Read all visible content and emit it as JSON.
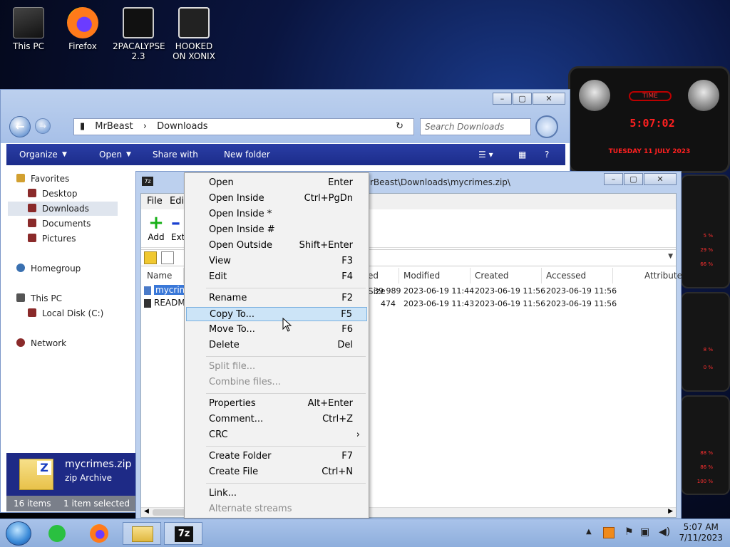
{
  "desktop": {
    "icons": [
      {
        "label": "This PC"
      },
      {
        "label": "Firefox"
      },
      {
        "label": "2PACALYPSE 2.3"
      },
      {
        "label": "HOOKED ON XONIX"
      }
    ]
  },
  "widget": {
    "time_label": "TIME",
    "time": "5:07:02",
    "date": "TUESDAY 11 JULY 2023",
    "readouts": [
      "5 %",
      "29 %",
      "66 %",
      "8 %",
      "0 %",
      "0 %",
      "88 %",
      "86 %",
      "100 %"
    ]
  },
  "explorer": {
    "breadcrumb": [
      "MrBeast",
      "Downloads"
    ],
    "search_placeholder": "Search Downloads",
    "toolbar": {
      "organize": "Organize",
      "open": "Open",
      "share_with": "Share with",
      "new_folder": "New folder"
    },
    "nav": {
      "favorites": "Favorites",
      "desktop": "Desktop",
      "downloads": "Downloads",
      "documents": "Documents",
      "pictures": "Pictures",
      "homegroup": "Homegroup",
      "this_pc": "This PC",
      "local_disk": "Local Disk (C:)",
      "network": "Network"
    },
    "details": {
      "name": "mycrimes.zip",
      "type": "zip Archive"
    },
    "status": {
      "items": "16 items",
      "selected": "1 item selected"
    }
  },
  "zip": {
    "title": "rBeast\\Downloads\\mycrimes.zip\\",
    "menu": {
      "file": "File",
      "edit": "Edi"
    },
    "tools": {
      "add": "Add",
      "extract": "Ext"
    },
    "columns": {
      "name": "Name",
      "size": "ed Size",
      "modified": "Modified",
      "created": "Created",
      "accessed": "Accessed",
      "attributes": "Attribute"
    },
    "rows": [
      {
        "name": "mycrim",
        "size": "39 989",
        "modified": "2023-06-19 11:44",
        "created": "2023-06-19 11:56",
        "accessed": "2023-06-19 11:56"
      },
      {
        "name": "READM",
        "size": "474",
        "modified": "2023-06-19 11:43",
        "created": "2023-06-19 11:56",
        "accessed": "2023-06-19 11:56"
      }
    ]
  },
  "context_menu": {
    "items": [
      {
        "label": "Open",
        "shortcut": "Enter"
      },
      {
        "label": "Open Inside",
        "shortcut": "Ctrl+PgDn"
      },
      {
        "label": "Open Inside *",
        "shortcut": ""
      },
      {
        "label": "Open Inside #",
        "shortcut": ""
      },
      {
        "label": "Open Outside",
        "shortcut": "Shift+Enter"
      },
      {
        "label": "View",
        "shortcut": "F3"
      },
      {
        "label": "Edit",
        "shortcut": "F4"
      },
      {
        "label": "Rename",
        "shortcut": "F2"
      },
      {
        "label": "Copy To...",
        "shortcut": "F5"
      },
      {
        "label": "Move To...",
        "shortcut": "F6"
      },
      {
        "label": "Delete",
        "shortcut": "Del"
      },
      {
        "label": "Split file...",
        "shortcut": ""
      },
      {
        "label": "Combine files...",
        "shortcut": ""
      },
      {
        "label": "Properties",
        "shortcut": "Alt+Enter"
      },
      {
        "label": "Comment...",
        "shortcut": "Ctrl+Z"
      },
      {
        "label": "CRC",
        "shortcut": "›"
      },
      {
        "label": "Create Folder",
        "shortcut": "F7"
      },
      {
        "label": "Create File",
        "shortcut": "Ctrl+N"
      },
      {
        "label": "Link...",
        "shortcut": ""
      },
      {
        "label": "Alternate streams",
        "shortcut": ""
      }
    ]
  },
  "taskbar": {
    "time": "5:07 AM",
    "date": "7/11/2023",
    "zip_label": "7z"
  },
  "colors": {
    "explorer_toolbar": "#1c2c8a",
    "menu_highlight": "#cce4f7",
    "widget_text": "#ff2020"
  }
}
